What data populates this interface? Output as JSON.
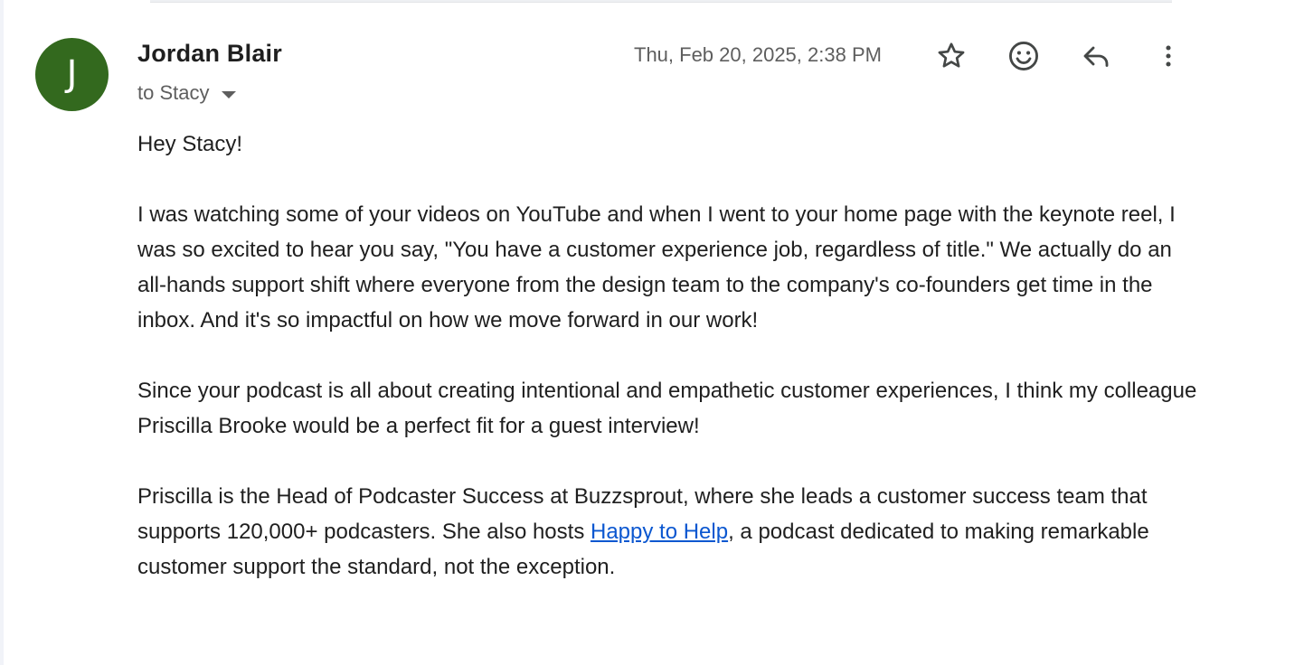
{
  "message": {
    "sender": {
      "name": "Jordan Blair",
      "initial": "J",
      "avatar_color": "#33691e"
    },
    "recipient": "to Stacy",
    "timestamp": "Thu, Feb 20, 2025, 2:38 PM",
    "actions": [
      "star-icon",
      "emoji-icon",
      "reply-icon",
      "more-vert-icon"
    ],
    "body": {
      "greeting": "Hey Stacy!",
      "p1": "I was watching some of your videos on YouTube and when I went to your home page with the keynote reel, I was so excited to hear you say, \"You have a customer experience job, regardless of title.\" We actually do an all-hands support shift where everyone from the design team to the company's co-founders get time in the inbox. And it's so impactful on how we move forward in our work!",
      "p2": "Since your podcast is all about creating intentional and empathetic customer experiences, I think my colleague Priscilla Brooke would be a perfect fit for a guest interview!",
      "p3_before": "Priscilla is the Head of Podcaster Success at Buzzsprout, where she leads a customer success team that supports 120,000+ podcasters. She also hosts ",
      "p3_link": "Happy to Help",
      "p3_after": ", a podcast dedicated to making remarkable customer support the standard, not the exception."
    },
    "link_color": "#0b57d0"
  }
}
